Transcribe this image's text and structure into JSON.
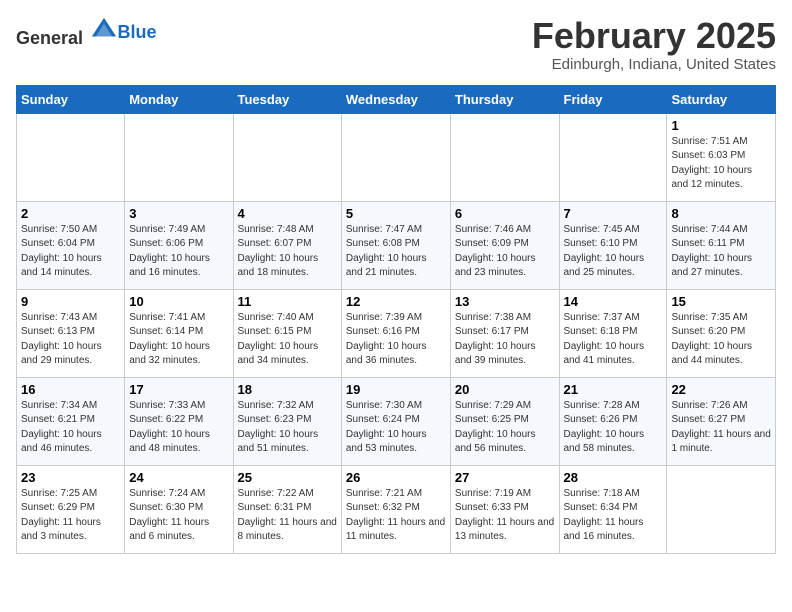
{
  "app": {
    "logo_general": "General",
    "logo_blue": "Blue"
  },
  "header": {
    "title": "February 2025",
    "subtitle": "Edinburgh, Indiana, United States"
  },
  "calendar": {
    "weekdays": [
      "Sunday",
      "Monday",
      "Tuesday",
      "Wednesday",
      "Thursday",
      "Friday",
      "Saturday"
    ],
    "weeks": [
      [
        {
          "day": "",
          "info": ""
        },
        {
          "day": "",
          "info": ""
        },
        {
          "day": "",
          "info": ""
        },
        {
          "day": "",
          "info": ""
        },
        {
          "day": "",
          "info": ""
        },
        {
          "day": "",
          "info": ""
        },
        {
          "day": "1",
          "info": "Sunrise: 7:51 AM\nSunset: 6:03 PM\nDaylight: 10 hours\nand 12 minutes."
        }
      ],
      [
        {
          "day": "2",
          "info": "Sunrise: 7:50 AM\nSunset: 6:04 PM\nDaylight: 10 hours\nand 14 minutes."
        },
        {
          "day": "3",
          "info": "Sunrise: 7:49 AM\nSunset: 6:06 PM\nDaylight: 10 hours\nand 16 minutes."
        },
        {
          "day": "4",
          "info": "Sunrise: 7:48 AM\nSunset: 6:07 PM\nDaylight: 10 hours\nand 18 minutes."
        },
        {
          "day": "5",
          "info": "Sunrise: 7:47 AM\nSunset: 6:08 PM\nDaylight: 10 hours\nand 21 minutes."
        },
        {
          "day": "6",
          "info": "Sunrise: 7:46 AM\nSunset: 6:09 PM\nDaylight: 10 hours\nand 23 minutes."
        },
        {
          "day": "7",
          "info": "Sunrise: 7:45 AM\nSunset: 6:10 PM\nDaylight: 10 hours\nand 25 minutes."
        },
        {
          "day": "8",
          "info": "Sunrise: 7:44 AM\nSunset: 6:11 PM\nDaylight: 10 hours\nand 27 minutes."
        }
      ],
      [
        {
          "day": "9",
          "info": "Sunrise: 7:43 AM\nSunset: 6:13 PM\nDaylight: 10 hours\nand 29 minutes."
        },
        {
          "day": "10",
          "info": "Sunrise: 7:41 AM\nSunset: 6:14 PM\nDaylight: 10 hours\nand 32 minutes."
        },
        {
          "day": "11",
          "info": "Sunrise: 7:40 AM\nSunset: 6:15 PM\nDaylight: 10 hours\nand 34 minutes."
        },
        {
          "day": "12",
          "info": "Sunrise: 7:39 AM\nSunset: 6:16 PM\nDaylight: 10 hours\nand 36 minutes."
        },
        {
          "day": "13",
          "info": "Sunrise: 7:38 AM\nSunset: 6:17 PM\nDaylight: 10 hours\nand 39 minutes."
        },
        {
          "day": "14",
          "info": "Sunrise: 7:37 AM\nSunset: 6:18 PM\nDaylight: 10 hours\nand 41 minutes."
        },
        {
          "day": "15",
          "info": "Sunrise: 7:35 AM\nSunset: 6:20 PM\nDaylight: 10 hours\nand 44 minutes."
        }
      ],
      [
        {
          "day": "16",
          "info": "Sunrise: 7:34 AM\nSunset: 6:21 PM\nDaylight: 10 hours\nand 46 minutes."
        },
        {
          "day": "17",
          "info": "Sunrise: 7:33 AM\nSunset: 6:22 PM\nDaylight: 10 hours\nand 48 minutes."
        },
        {
          "day": "18",
          "info": "Sunrise: 7:32 AM\nSunset: 6:23 PM\nDaylight: 10 hours\nand 51 minutes."
        },
        {
          "day": "19",
          "info": "Sunrise: 7:30 AM\nSunset: 6:24 PM\nDaylight: 10 hours\nand 53 minutes."
        },
        {
          "day": "20",
          "info": "Sunrise: 7:29 AM\nSunset: 6:25 PM\nDaylight: 10 hours\nand 56 minutes."
        },
        {
          "day": "21",
          "info": "Sunrise: 7:28 AM\nSunset: 6:26 PM\nDaylight: 10 hours\nand 58 minutes."
        },
        {
          "day": "22",
          "info": "Sunrise: 7:26 AM\nSunset: 6:27 PM\nDaylight: 11 hours\nand 1 minute."
        }
      ],
      [
        {
          "day": "23",
          "info": "Sunrise: 7:25 AM\nSunset: 6:29 PM\nDaylight: 11 hours\nand 3 minutes."
        },
        {
          "day": "24",
          "info": "Sunrise: 7:24 AM\nSunset: 6:30 PM\nDaylight: 11 hours\nand 6 minutes."
        },
        {
          "day": "25",
          "info": "Sunrise: 7:22 AM\nSunset: 6:31 PM\nDaylight: 11 hours\nand 8 minutes."
        },
        {
          "day": "26",
          "info": "Sunrise: 7:21 AM\nSunset: 6:32 PM\nDaylight: 11 hours\nand 11 minutes."
        },
        {
          "day": "27",
          "info": "Sunrise: 7:19 AM\nSunset: 6:33 PM\nDaylight: 11 hours\nand 13 minutes."
        },
        {
          "day": "28",
          "info": "Sunrise: 7:18 AM\nSunset: 6:34 PM\nDaylight: 11 hours\nand 16 minutes."
        },
        {
          "day": "",
          "info": ""
        }
      ]
    ]
  }
}
